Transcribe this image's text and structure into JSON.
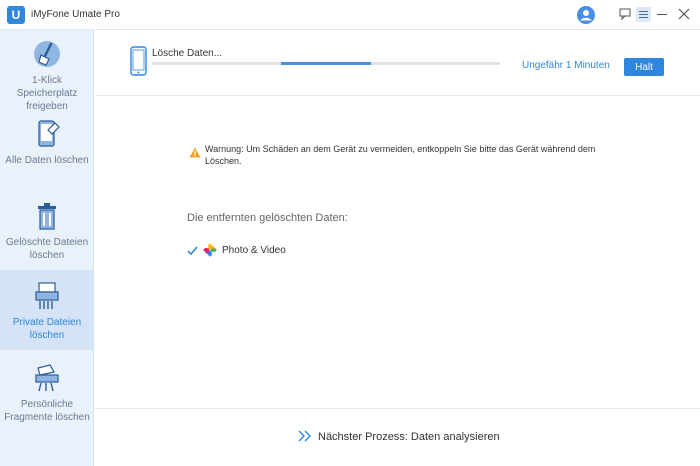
{
  "app": {
    "title": "iMyFone Umate Pro",
    "logo_letter": "U"
  },
  "sidebar": {
    "items": [
      {
        "label": "1-Klick Speicherplatz freigeben",
        "icon": "broom-icon",
        "active": false
      },
      {
        "label": "Alle Daten löschen",
        "icon": "phone-eraser-icon",
        "active": false
      },
      {
        "label": "Gelöschte Dateien löschen",
        "icon": "trash-icon",
        "active": false
      },
      {
        "label": "Private Dateien löschen",
        "icon": "shredder-icon",
        "active": true
      },
      {
        "label": "Persönliche Fragmente löschen",
        "icon": "fragment-shredder-icon",
        "active": false
      }
    ]
  },
  "progress": {
    "label": "Lösche Daten...",
    "eta": "Ungefähr 1 Minuten",
    "halt_label": "Halt",
    "fill_start": 0.37,
    "fill_end": 0.63
  },
  "warning": {
    "text": "Warnung: Um Schäden an dem Gerät zu vermeiden, entkoppeln Sie bitte das Gerät während dem Löschen."
  },
  "deleted": {
    "heading": "Die entfernten gelöschten Daten:",
    "items": [
      {
        "label": "Photo & Video",
        "icon": "photos-icon"
      }
    ]
  },
  "footer": {
    "next_process": "Nächster Prozess: Daten analysieren"
  },
  "colors": {
    "accent": "#2e86de",
    "sidebar_bg": "#e9f1fb",
    "sidebar_active": "#d4e3f5",
    "warning": "#f0a020"
  }
}
